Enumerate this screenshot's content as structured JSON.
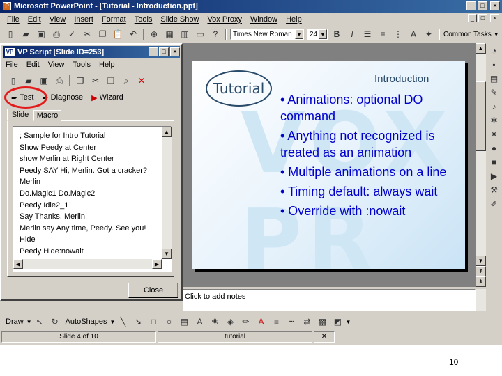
{
  "app": {
    "title": "Microsoft PowerPoint - [Tutorial - Introduction.ppt]",
    "window_controls": [
      "_",
      "□",
      "×"
    ],
    "doc_controls": [
      "_",
      "□",
      "×"
    ]
  },
  "menu": [
    "File",
    "Edit",
    "View",
    "Insert",
    "Format",
    "Tools",
    "Slide Show",
    "Vox Proxy",
    "Window",
    "Help"
  ],
  "toolbar": {
    "font_name": "Times New Roman",
    "font_size": "24",
    "common_tasks": "Common Tasks"
  },
  "dialog": {
    "title": "VP Script [Slide ID=253]",
    "menu": [
      "File",
      "Edit",
      "View",
      "Tools",
      "Help"
    ],
    "actions": {
      "test": "Test",
      "diagnose": "Diagnose",
      "wizard": "Wizard"
    },
    "tabs": [
      "Slide",
      "Macro"
    ],
    "script_lines": [
      "; Sample for Intro Tutorial",
      "Show Peedy at Center",
      "show Merlin at Right Center",
      "Peedy SAY Hi, Merlin. Got a cracker?",
      "Merlin",
      "Do.Magic1 Do.Magic2",
      "Peedy Idle2_1",
      "Say Thanks, Merlin!",
      "Merlin say Any time, Peedy. See you!",
      "Hide",
      "Peedy Hide:nowait"
    ],
    "close_label": "Close"
  },
  "slide": {
    "title": "Introduction",
    "logo_text": "Tutorial",
    "watermark": "VOX PR",
    "bullets": [
      "• Animations: optional DO command",
      "• Anything not recognized is treated as an animation",
      "• Multiple animations on a line",
      "• Timing default: always wait",
      "• Override with :nowait"
    ]
  },
  "notes": {
    "placeholder": "Click to add notes"
  },
  "drawbar": {
    "draw": "Draw",
    "autoshapes": "AutoShapes"
  },
  "status": {
    "slide_position": "Slide 4 of 10",
    "design": "tutorial"
  },
  "page_number": "10",
  "colors": {
    "accent_title": "#0a246a",
    "bullet_text": "#0000cc",
    "highlight_oval": "#e31b1b"
  }
}
